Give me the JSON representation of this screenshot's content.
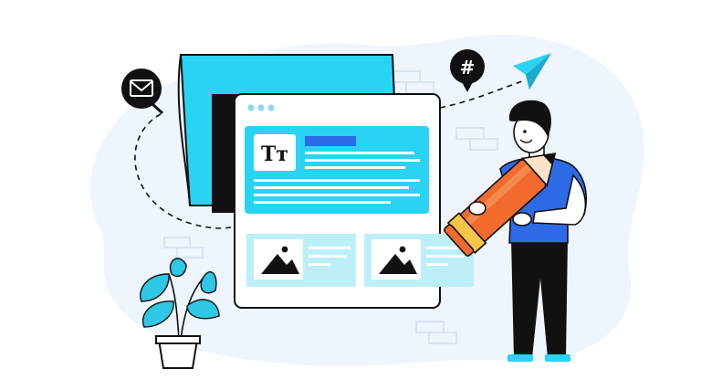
{
  "illustration": {
    "typography_glyph": "Tт",
    "hashtag_glyph": "#"
  },
  "icons": {
    "mail": "mail-icon",
    "hashtag": "hashtag-icon",
    "paper_plane": "paper-plane-icon",
    "image": "image-icon",
    "window_dots": "window-dots-icon"
  },
  "colors": {
    "accent_cyan": "#29D3F3",
    "light_cyan": "#BDEFF9",
    "blob_bg": "#EEF5FD",
    "shirt_blue": "#2D6BE6",
    "pencil_orange": "#F26A2E",
    "plant_teal": "#2EC7E6",
    "outline_dark": "#111111"
  }
}
